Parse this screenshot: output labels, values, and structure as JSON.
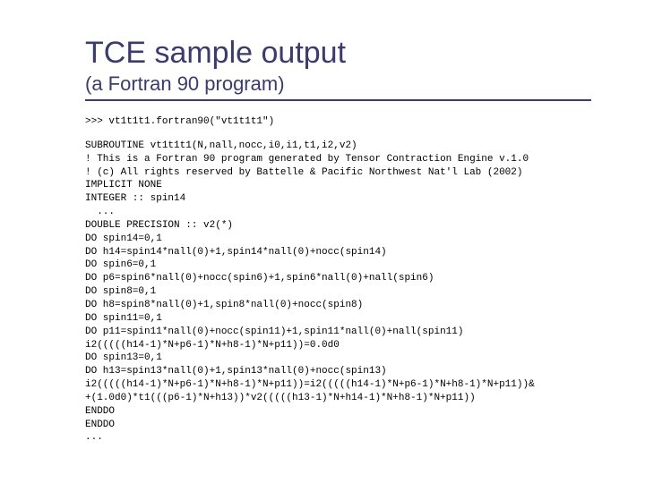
{
  "title": "TCE sample output",
  "subtitle": "(a Fortran 90 program)",
  "replLine": ">>> vt1t1t1.fortran90(\"vt1t1t1\")",
  "codeLines": [
    "SUBROUTINE vt1t1t1(N,nall,nocc,i0,i1,t1,i2,v2)",
    "! This is a Fortran 90 program generated by Tensor Contraction Engine v.1.0",
    "! (c) All rights reserved by Battelle & Pacific Northwest Nat'l Lab (2002)",
    "IMPLICIT NONE",
    "INTEGER :: spin14",
    "  ...",
    "DOUBLE PRECISION :: v2(*)",
    "DO spin14=0,1",
    "DO h14=spin14*nall(0)+1,spin14*nall(0)+nocc(spin14)",
    "DO spin6=0,1",
    "DO p6=spin6*nall(0)+nocc(spin6)+1,spin6*nall(0)+nall(spin6)",
    "DO spin8=0,1",
    "DO h8=spin8*nall(0)+1,spin8*nall(0)+nocc(spin8)",
    "DO spin11=0,1",
    "DO p11=spin11*nall(0)+nocc(spin11)+1,spin11*nall(0)+nall(spin11)",
    "i2(((((h14-1)*N+p6-1)*N+h8-1)*N+p11))=0.0d0",
    "DO spin13=0,1",
    "DO h13=spin13*nall(0)+1,spin13*nall(0)+nocc(spin13)",
    "i2(((((h14-1)*N+p6-1)*N+h8-1)*N+p11))=i2(((((h14-1)*N+p6-1)*N+h8-1)*N+p11))&",
    "+(1.0d0)*t1(((p6-1)*N+h13))*v2(((((h13-1)*N+h14-1)*N+h8-1)*N+p11))",
    "ENDDO",
    "ENDDO",
    "..."
  ]
}
